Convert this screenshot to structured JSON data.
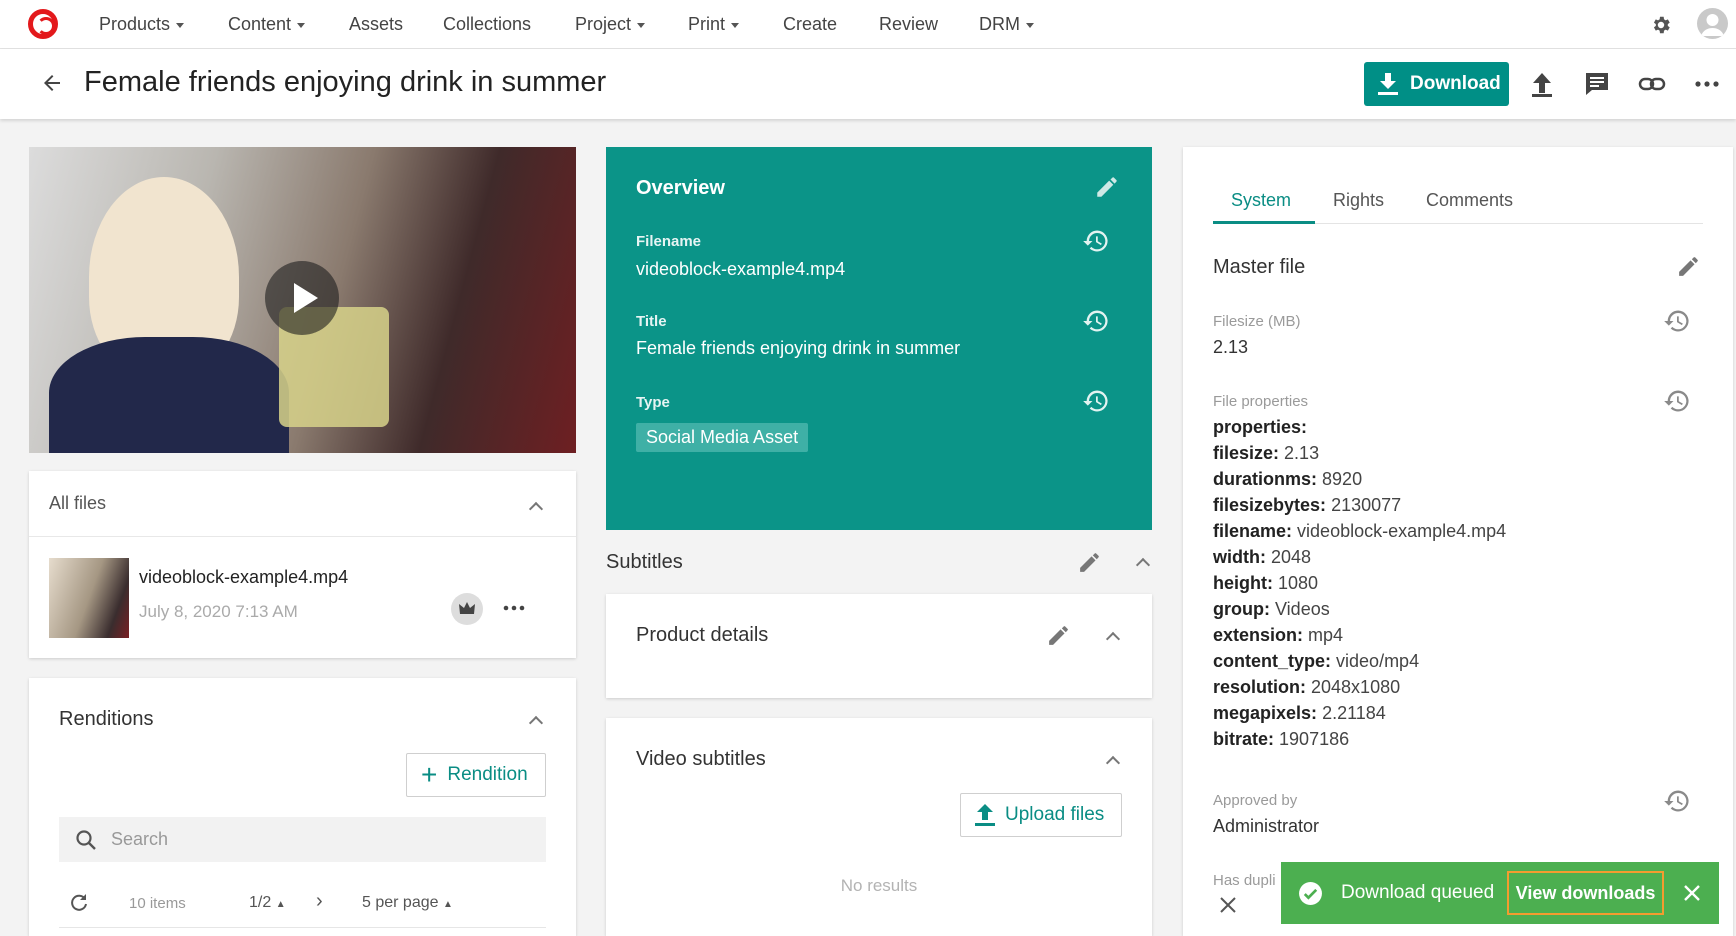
{
  "nav": {
    "items": [
      {
        "label": "Products",
        "caret": true
      },
      {
        "label": "Content",
        "caret": true
      },
      {
        "label": "Assets",
        "caret": false
      },
      {
        "label": "Collections",
        "caret": false
      },
      {
        "label": "Project",
        "caret": true
      },
      {
        "label": "Print",
        "caret": true
      },
      {
        "label": "Create",
        "caret": false
      },
      {
        "label": "Review",
        "caret": false
      },
      {
        "label": "DRM",
        "caret": true
      }
    ]
  },
  "header": {
    "title": "Female friends enjoying drink in summer",
    "download_label": "Download"
  },
  "files": {
    "heading": "All files",
    "file_name": "videoblock-example4.mp4",
    "file_date": "July 8, 2020 7:13 AM"
  },
  "renditions": {
    "heading": "Renditions",
    "add_label": "Rendition",
    "search_placeholder": "Search",
    "items_count": "10 items",
    "page": "1/2",
    "per_page": "5 per page"
  },
  "overview": {
    "heading": "Overview",
    "filename_label": "Filename",
    "filename_value": "videoblock-example4.mp4",
    "title_label": "Title",
    "title_value": "Female friends enjoying drink in summer",
    "type_label": "Type",
    "type_value": "Social Media Asset"
  },
  "subtitles": {
    "heading": "Subtitles"
  },
  "product_details": {
    "heading": "Product details"
  },
  "video_subtitles": {
    "heading": "Video subtitles",
    "upload_label": "Upload files",
    "empty_text": "No results"
  },
  "system": {
    "tabs": [
      "System",
      "Rights",
      "Comments"
    ],
    "active_tab": "System",
    "master_heading": "Master file",
    "filesize_label": "Filesize (MB)",
    "filesize_value": "2.13",
    "props_label": "File properties",
    "props_heading": "properties:",
    "properties": [
      {
        "k": "filesize:",
        "v": "2.13"
      },
      {
        "k": "durationms:",
        "v": "8920"
      },
      {
        "k": "filesizebytes:",
        "v": "2130077"
      },
      {
        "k": "filename:",
        "v": "videoblock-example4.mp4"
      },
      {
        "k": "width:",
        "v": "2048"
      },
      {
        "k": "height:",
        "v": "1080"
      },
      {
        "k": "group:",
        "v": "Videos"
      },
      {
        "k": "extension:",
        "v": "mp4"
      },
      {
        "k": "content_type:",
        "v": "video/mp4"
      },
      {
        "k": "resolution:",
        "v": "2048x1080"
      },
      {
        "k": "megapixels:",
        "v": "2.21184"
      },
      {
        "k": "bitrate:",
        "v": "1907186"
      }
    ],
    "approved_label": "Approved by",
    "approved_value": "Administrator",
    "has_dupl_label": "Has dupli"
  },
  "toast": {
    "message": "Download queued",
    "action_label": "View downloads"
  },
  "colors": {
    "accent": "#008f86",
    "overview_bg": "#0b9488",
    "toast_bg": "#4caf50",
    "toast_outline": "#f39c2f"
  }
}
